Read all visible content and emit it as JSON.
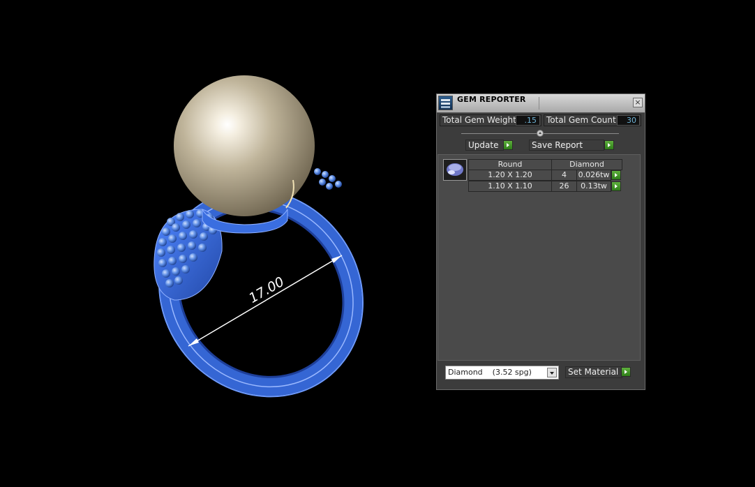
{
  "viewport": {
    "dimension_label": "17.00"
  },
  "panel": {
    "title": "GEM REPORTER",
    "close_icon": "×",
    "total_gem_weight_label": "Total Gem Weight",
    "total_gem_weight_value": ".15",
    "total_gem_count_label": "Total Gem Count",
    "total_gem_count_value": "30",
    "update_label": "Update",
    "save_report_label": "Save Report",
    "table": {
      "shape": "Round",
      "material": "Diamond",
      "rows": [
        {
          "size": "1.20 X 1.20",
          "count": "4",
          "weight": "0.026tw"
        },
        {
          "size": "1.10 X 1.10",
          "count": "26",
          "weight": "0.13tw"
        }
      ]
    },
    "material_select": "Diamond    (3.52 spg)",
    "set_material_label": "Set Material"
  },
  "colors": {
    "ring": "#3b6fd4",
    "pearl": "#c9bfa7",
    "panel_bg": "#3c3c3c",
    "accent_green": "#3f9a24"
  }
}
